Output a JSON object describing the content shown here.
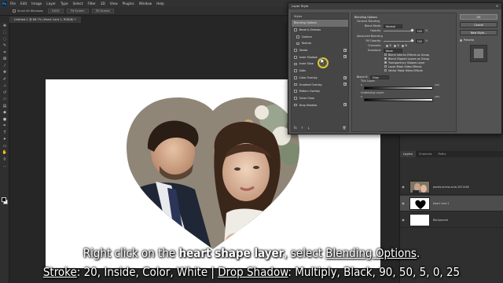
{
  "menubar": {
    "logo": "Ps",
    "items": [
      "File",
      "Edit",
      "Image",
      "Layer",
      "Type",
      "Select",
      "Filter",
      "3D",
      "View",
      "Plugins",
      "Window",
      "Help"
    ]
  },
  "options_bar": {
    "scroll_all_label": "Scroll All Windows",
    "zoom_value": "100%",
    "fit_screen_label": "Fit Screen",
    "fill_screen_label": "Fill Screen"
  },
  "document": {
    "tab_title": "Untitled-1 @ 66.7% (Heart Card 1, RGB/8) *"
  },
  "dialog": {
    "title": "Layer Style",
    "close_glyph": "✕",
    "styles_header": "Styles",
    "style_items": [
      {
        "label": "Blending Options",
        "checkbox": false,
        "plus": false,
        "selected": true
      },
      {
        "label": "Bevel & Emboss",
        "checkbox": true,
        "plus": false
      },
      {
        "label": "Contour",
        "checkbox": true,
        "plus": false,
        "indent": true
      },
      {
        "label": "Texture",
        "checkbox": true,
        "plus": false,
        "indent": true
      },
      {
        "label": "Stroke",
        "checkbox": true,
        "plus": true
      },
      {
        "label": "Inner Shadow",
        "checkbox": true,
        "plus": true
      },
      {
        "label": "Inner Glow",
        "checkbox": true,
        "plus": false
      },
      {
        "label": "Satin",
        "checkbox": true,
        "plus": false
      },
      {
        "label": "Color Overlay",
        "checkbox": true,
        "plus": true
      },
      {
        "label": "Gradient Overlay",
        "checkbox": true,
        "plus": true
      },
      {
        "label": "Pattern Overlay",
        "checkbox": true,
        "plus": false
      },
      {
        "label": "Outer Glow",
        "checkbox": true,
        "plus": false
      },
      {
        "label": "Drop Shadow",
        "checkbox": true,
        "plus": true
      }
    ],
    "fx_footer": {
      "fx": "fx",
      "up": "↑",
      "down": "↓",
      "trash": "🗑"
    },
    "main": {
      "section_title": "Blending Options",
      "general_blending": "General Blending",
      "blend_mode_label": "Blend Mode:",
      "blend_mode_value": "Normal",
      "opacity_label": "Opacity:",
      "opacity_value": 100,
      "opacity_unit": "%",
      "advanced_blending": "Advanced Blending",
      "fill_opacity_label": "Fill Opacity:",
      "fill_opacity_value": 100,
      "channels_label": "Channels:",
      "channels": [
        "R",
        "G",
        "B"
      ],
      "knockout_label": "Knockout:",
      "knockout_value": "None",
      "checkbox_options": [
        {
          "label": "Blend Interior Effects as Group",
          "checked": false
        },
        {
          "label": "Blend Clipped Layers as Group",
          "checked": true
        },
        {
          "label": "Transparency Shapes Layer",
          "checked": true
        },
        {
          "label": "Layer Mask Hides Effects",
          "checked": false
        },
        {
          "label": "Vector Mask Hides Effects",
          "checked": false
        }
      ],
      "blend_if_label": "Blend If:",
      "blend_if_value": "Gray",
      "this_layer_label": "This Layer:",
      "underlying_layer_label": "Underlying Layer:",
      "range_min": "0",
      "range_max": "255"
    },
    "buttons": {
      "ok": "OK",
      "cancel": "Cancel",
      "new_style": "New Style...",
      "preview": "Preview"
    }
  },
  "layers_panel": {
    "tabs": [
      "Layers",
      "Channels",
      "Paths"
    ],
    "layers": [
      {
        "name": "pexels-emma-scire-2871448",
        "kind": "photo",
        "selected": false
      },
      {
        "name": "Heart Card 1",
        "kind": "heart",
        "selected": true
      },
      {
        "name": "Background",
        "kind": "white",
        "selected": false
      }
    ]
  },
  "caption": {
    "line1_pre": "Right click on the ",
    "line1_bold": "heart shape layer",
    "line1_mid": ", select ",
    "line1_link": "Blending Options",
    "line1_end": ".",
    "line2_stroke": "Stroke",
    "line2_stroke_values": ": 20, Inside, Color, White  |  ",
    "line2_shadow": "Drop Shadow",
    "line2_shadow_values": ": Multiply, Black, 90, 50, 5, 0, 25"
  }
}
